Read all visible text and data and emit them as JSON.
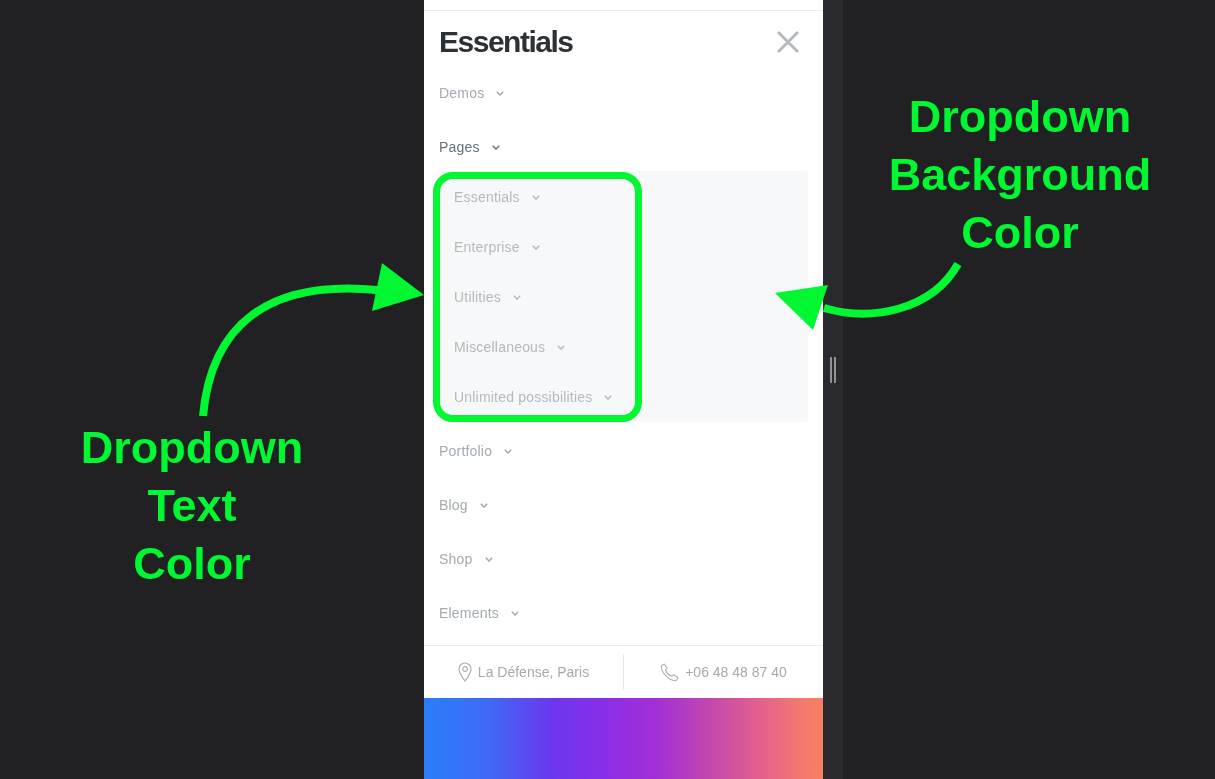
{
  "menu_panel": {
    "title": "Essentials",
    "items": [
      {
        "label": "Demos",
        "expanded": false,
        "highlighted": false
      },
      {
        "label": "Pages",
        "expanded": true,
        "highlighted": true,
        "children": [
          {
            "label": "Essentials",
            "expanded": false
          },
          {
            "label": "Enterprise",
            "expanded": false
          },
          {
            "label": "Utilities",
            "expanded": false
          },
          {
            "label": "Miscellaneous",
            "expanded": false
          },
          {
            "label": "Unlimited possibilities",
            "expanded": false
          }
        ]
      },
      {
        "label": "Portfolio",
        "expanded": false,
        "highlighted": false
      },
      {
        "label": "Blog",
        "expanded": false,
        "highlighted": false
      },
      {
        "label": "Shop",
        "expanded": false,
        "highlighted": false
      },
      {
        "label": "Elements",
        "expanded": false,
        "highlighted": false
      }
    ],
    "contact": [
      {
        "kind": "location",
        "text": "La Défense, Paris"
      },
      {
        "kind": "phone",
        "text": "+06 48 48 87 40"
      }
    ]
  },
  "annotations": [
    {
      "text": "Dropdown Text Color",
      "kind": "left"
    },
    {
      "text": "Dropdown Background Color",
      "kind": "right"
    }
  ]
}
